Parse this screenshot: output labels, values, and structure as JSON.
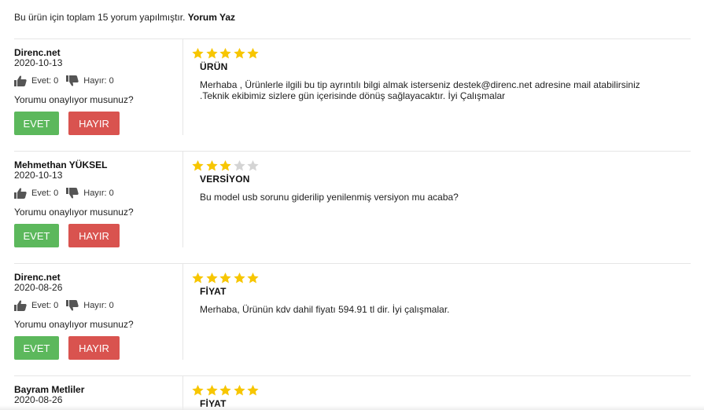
{
  "summary": {
    "text": "Bu ürün için toplam 15 yorum yapılmıştır.",
    "write_label": "Yorum Yaz"
  },
  "colors": {
    "star_filled": "#f7c600",
    "star_empty": "#d4d4d4",
    "yes_button": "#5cb85c",
    "no_button": "#d9534f"
  },
  "reviews": [
    {
      "author": "Direnc.net",
      "date": "2020-10-13",
      "rating": 5,
      "yes_vote": "Evet: 0",
      "no_vote": "Hayır: 0",
      "question": "Yorumu onaylıyor musunuz?",
      "yes_button": "EVET",
      "no_button": "HAYIR",
      "title": "ÜRÜN",
      "text": "Merhaba , Ürünlerle ilgili bu tip ayrıntılı bilgi almak isterseniz destek@direnc.net adresine mail atabilirsiniz .Teknik ekibimiz sizlere gün içerisinde dönüş sağlayacaktır. İyi Çalışmalar"
    },
    {
      "author": "Mehmethan YÜKSEL",
      "date": "2020-10-13",
      "rating": 3,
      "yes_vote": "Evet: 0",
      "no_vote": "Hayır: 0",
      "question": "Yorumu onaylıyor musunuz?",
      "yes_button": "EVET",
      "no_button": "HAYIR",
      "title": "VERSİYON",
      "text": "Bu model usb sorunu giderilip yenilenmiş versiyon mu acaba?"
    },
    {
      "author": "Direnc.net",
      "date": "2020-08-26",
      "rating": 5,
      "yes_vote": "Evet: 0",
      "no_vote": "Hayır: 0",
      "question": "Yorumu onaylıyor musunuz?",
      "yes_button": "EVET",
      "no_button": "HAYIR",
      "title": "FİYAT",
      "text": "Merhaba, Ürünün kdv dahil fiyatı 594.91 tl dir. İyi çalışmalar."
    },
    {
      "author": "Bayram Metliler",
      "date": "2020-08-26",
      "rating": 5,
      "yes_vote": "",
      "no_vote": "",
      "question": "",
      "yes_button": "",
      "no_button": "",
      "title": "FİYAT",
      "text": ""
    }
  ]
}
